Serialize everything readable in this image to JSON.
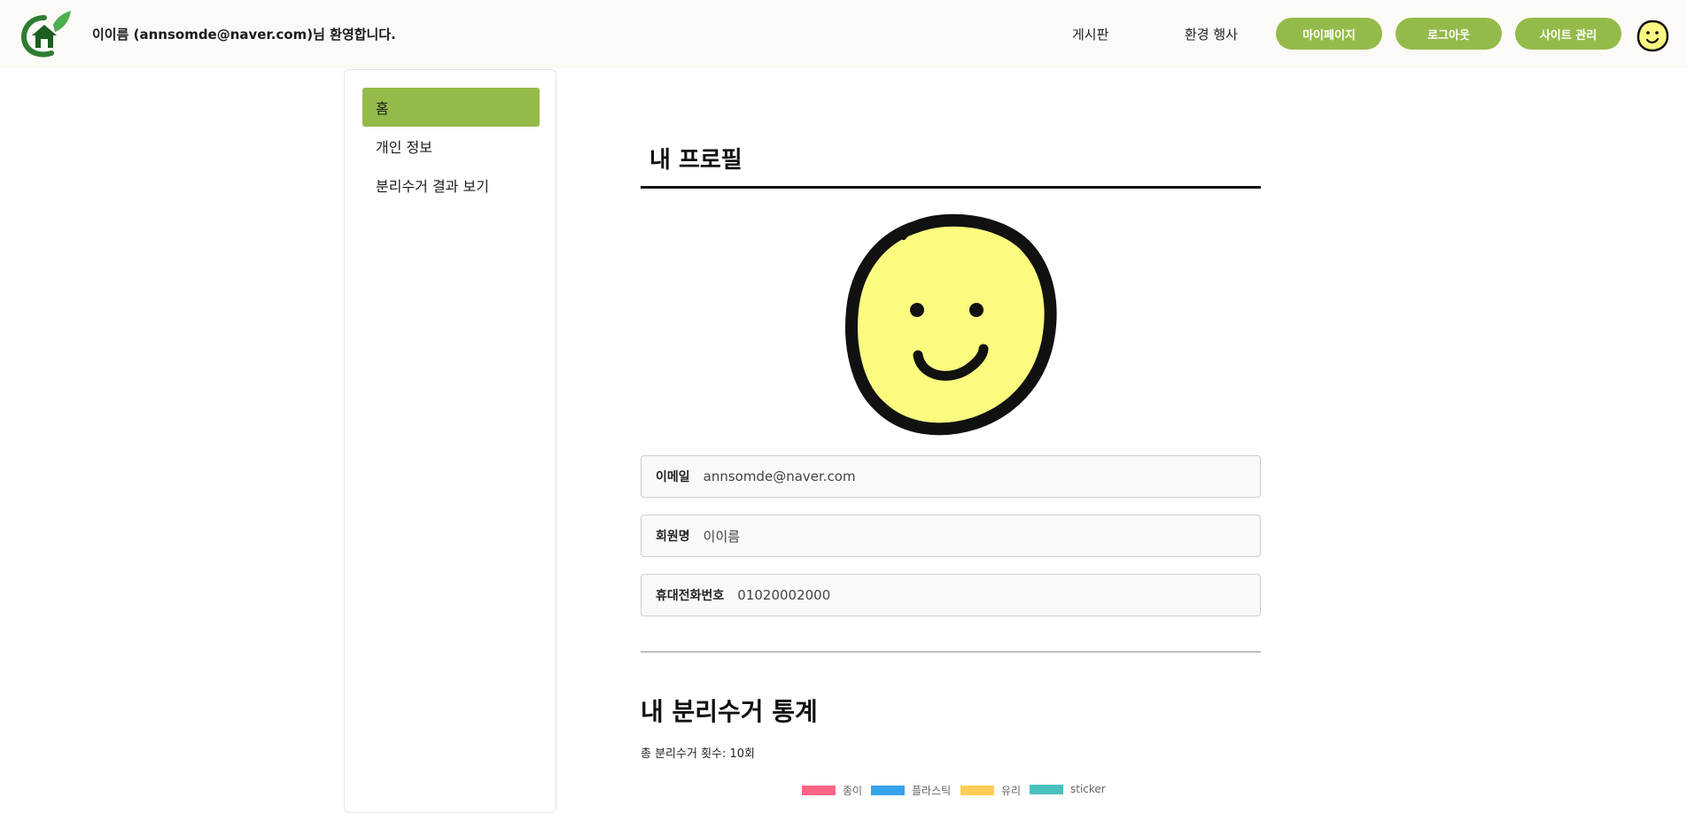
{
  "header": {
    "welcome": "이이름 (annsomde@naver.com)님 환영합니다.",
    "nav": [
      "게시판",
      "환경 행사"
    ],
    "buttons": [
      "마이페이지",
      "로그아웃",
      "사이트 관리"
    ],
    "accent_color": "#94bb4a"
  },
  "sidebar": {
    "items": [
      {
        "label": "홈",
        "active": true
      },
      {
        "label": "개인 정보",
        "active": false
      },
      {
        "label": "분리수거 결과 보기",
        "active": false
      }
    ]
  },
  "profile": {
    "title": "내 프로필",
    "avatar_icon": "smiley-face-icon",
    "fields": [
      {
        "label": "이메일",
        "value": "annsomde@naver.com"
      },
      {
        "label": "회원명",
        "value": "이이름"
      },
      {
        "label": "휴대전화번호",
        "value": "01020002000"
      }
    ]
  },
  "stats": {
    "title": "내 분리수거 통계",
    "total": "총 분리수거 횟수: 10회"
  },
  "chart_data": {
    "type": "pie",
    "legend": [
      {
        "label": "종이",
        "color": "#ff6384"
      },
      {
        "label": "플라스틱",
        "color": "#36a2eb"
      },
      {
        "label": "유리",
        "color": "#ffce56"
      },
      {
        "label": "sticker",
        "color": "#4bc0c0"
      }
    ],
    "legend_placement": "top"
  }
}
